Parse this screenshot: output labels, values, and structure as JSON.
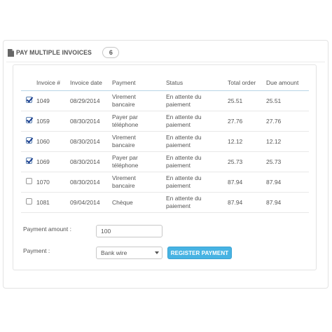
{
  "panel": {
    "title": "PAY MULTIPLE INVOICES",
    "count": "6",
    "icon": "document-icon"
  },
  "table": {
    "headers": [
      "Invoice #",
      "Invoice date",
      "Payment",
      "Status",
      "Total order",
      "Due amount"
    ],
    "rows": [
      {
        "checked": true,
        "invoice": "1049",
        "date": "08/29/2014",
        "payment_l1": "Virement",
        "payment_l2": "bancaire",
        "status_l1": "En attente du",
        "status_l2": "paiement",
        "total": "25.51",
        "due": "25.51"
      },
      {
        "checked": true,
        "invoice": "1059",
        "date": "08/30/2014",
        "payment_l1": "Payer par",
        "payment_l2": "téléphone",
        "status_l1": "En attente du",
        "status_l2": "paiement",
        "total": "27.76",
        "due": "27.76"
      },
      {
        "checked": true,
        "invoice": "1060",
        "date": "08/30/2014",
        "payment_l1": "Virement",
        "payment_l2": "bancaire",
        "status_l1": "En attente du",
        "status_l2": "paiement",
        "total": "12.12",
        "due": "12.12"
      },
      {
        "checked": true,
        "invoice": "1069",
        "date": "08/30/2014",
        "payment_l1": "Payer par",
        "payment_l2": "téléphone",
        "status_l1": "En attente du",
        "status_l2": "paiement",
        "total": "25.73",
        "due": "25.73"
      },
      {
        "checked": false,
        "invoice": "1070",
        "date": "08/30/2014",
        "payment_l1": "Virement",
        "payment_l2": "bancaire",
        "status_l1": "En attente du",
        "status_l2": "paiement",
        "total": "87.94",
        "due": "87.94"
      },
      {
        "checked": false,
        "invoice": "1081",
        "date": "09/04/2014",
        "payment_l1": "Chèque",
        "payment_l2": "",
        "status_l1": "En attente du",
        "status_l2": "paiement",
        "total": "87.94",
        "due": "87.94"
      }
    ]
  },
  "form": {
    "amount_label": "Payment amount :",
    "amount_value": "100",
    "payment_label": "Payment :",
    "payment_selected": "Bank wire",
    "register_label": "REGISTER PAYMENT"
  },
  "colors": {
    "accent": "#47b3e3",
    "header_rule": "#b8d5e6",
    "check": "#1a3f8f"
  }
}
